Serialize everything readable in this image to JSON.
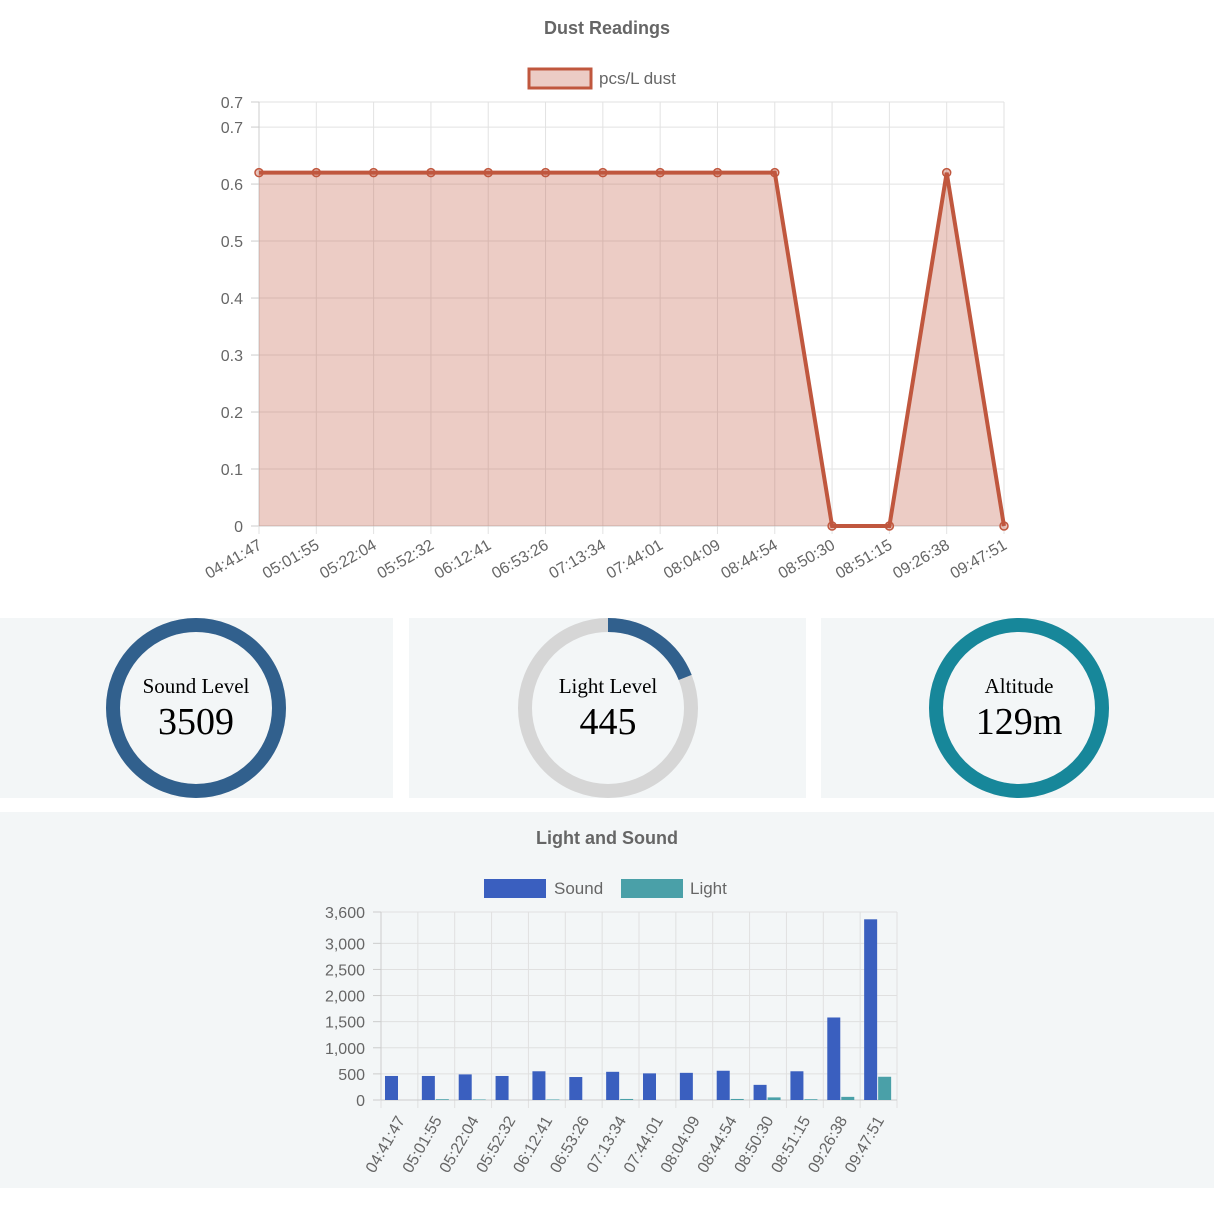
{
  "chart_data": [
    {
      "type": "area",
      "title": "Dust Readings",
      "legend": [
        "pcs/L dust"
      ],
      "legend_position": "top",
      "grid": true,
      "x": [
        "04:41:47",
        "05:01:55",
        "05:22:04",
        "05:52:32",
        "06:12:41",
        "06:53:26",
        "07:13:34",
        "07:44:01",
        "08:04:09",
        "08:44:54",
        "08:50:30",
        "08:51:15",
        "09:26:38",
        "09:47:51"
      ],
      "series": [
        {
          "name": "pcs/L dust",
          "values": [
            0.62,
            0.62,
            0.62,
            0.62,
            0.62,
            0.62,
            0.62,
            0.62,
            0.62,
            0.62,
            0,
            0,
            0.62,
            0
          ]
        }
      ],
      "y_ticks": [
        "0",
        "0.1",
        "0.2",
        "0.3",
        "0.4",
        "0.5",
        "0.6",
        "0.7",
        "0.7"
      ],
      "ylim": [
        0,
        0.744
      ],
      "colors": {
        "line": "#c0573e",
        "fill": "rgba(192,87,62,0.3)"
      }
    },
    {
      "type": "bar",
      "title": "Light and Sound",
      "legend_position": "top",
      "grid": true,
      "categories": [
        "04:41:47",
        "05:01:55",
        "05:22:04",
        "05:52:32",
        "06:12:41",
        "06:53:26",
        "07:13:34",
        "07:44:01",
        "08:04:09",
        "08:44:54",
        "08:50:30",
        "08:51:15",
        "09:26:38",
        "09:47:51"
      ],
      "series": [
        {
          "name": "Sound",
          "values": [
            460,
            460,
            490,
            460,
            550,
            440,
            540,
            510,
            520,
            560,
            290,
            550,
            1580,
            3460
          ],
          "color": "#3a5fbf"
        },
        {
          "name": "Light",
          "values": [
            0,
            15,
            10,
            0,
            10,
            0,
            20,
            0,
            0,
            20,
            50,
            15,
            60,
            445
          ],
          "color": "#4aa0a8"
        }
      ],
      "y_ticks": [
        "0",
        "500",
        "1,000",
        "1,500",
        "2,000",
        "2,500",
        "3,000",
        "3,600"
      ],
      "ylim": [
        0,
        3600
      ]
    }
  ],
  "gauges": [
    {
      "label": "Sound Level",
      "value": "3509",
      "fraction": 1.0,
      "color": "#31608d",
      "track": "#d6d6d6"
    },
    {
      "label": "Light Level",
      "value": "445",
      "fraction": 0.19,
      "color": "#31608d",
      "track": "#d6d6d6"
    },
    {
      "label": "Altitude",
      "value": "129m",
      "fraction": 1.0,
      "color": "#17879a",
      "track": "#d6d6d6"
    }
  ]
}
